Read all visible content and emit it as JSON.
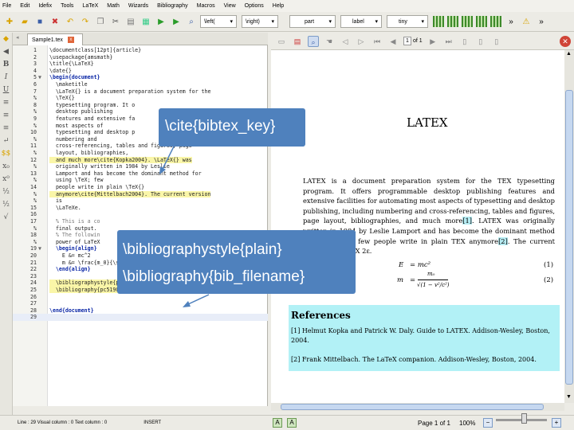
{
  "menu": [
    "File",
    "Edit",
    "Idefix",
    "Tools",
    "LaTeX",
    "Math",
    "Wizards",
    "Bibliography",
    "Macros",
    "View",
    "Options",
    "Help"
  ],
  "toolbar": {
    "left_dropdown": "\\left(",
    "right_dropdown": "\\right)",
    "part": "part",
    "label": "label",
    "size": "tiny"
  },
  "tab": {
    "name": "Sample1.tex"
  },
  "editor": {
    "lines": [
      {
        "n": "1",
        "m": "",
        "t": "\\documentclass[12pt]{article}"
      },
      {
        "n": "2",
        "m": "",
        "t": "\\usepackage{amsmath}"
      },
      {
        "n": "3",
        "m": "",
        "t": "\\title{\\LaTeX}"
      },
      {
        "n": "4",
        "m": "",
        "t": "\\date{}"
      },
      {
        "n": "5",
        "m": "▼",
        "t": "\\begin{document}"
      },
      {
        "n": "6",
        "m": "",
        "t": "  \\maketitle"
      },
      {
        "n": "7",
        "m": "",
        "t": "  \\LaTeX{} is a document preparation system for the"
      },
      {
        "n": "%",
        "m": "",
        "t": "  \\TeX{}"
      },
      {
        "n": "8",
        "m": "",
        "t": "  typesetting program. It o"
      },
      {
        "n": "%",
        "m": "",
        "t": "  desktop publishing"
      },
      {
        "n": "9",
        "m": "",
        "t": "  features and extensive fa"
      },
      {
        "n": "%",
        "m": "",
        "t": "  most aspects of"
      },
      {
        "n": "10",
        "m": "",
        "t": "  typesetting and desktop p"
      },
      {
        "n": "%",
        "m": "",
        "t": "  numbering and"
      },
      {
        "n": "11",
        "m": "",
        "t": "  cross-referencing, tables and figures, page"
      },
      {
        "n": "%",
        "m": "",
        "t": "  layout, bibliographies,"
      },
      {
        "n": "12",
        "m": "",
        "t": "  and much more\\cite{Kopka2004}. \\LaTeX{} was"
      },
      {
        "n": "%",
        "m": "",
        "t": "  originally written in 1984 by Leslie"
      },
      {
        "n": "13",
        "m": "",
        "t": "  Lamport and has become the dominant method for"
      },
      {
        "n": "%",
        "m": "",
        "t": "  using \\TeX; few"
      },
      {
        "n": "14",
        "m": "",
        "t": "  people write in plain \\TeX{}"
      },
      {
        "n": "%",
        "m": "",
        "t": "  anymore\\cite{Mittelbach2004}. The current version"
      },
      {
        "n": "%",
        "m": "",
        "t": "  is"
      },
      {
        "n": "15",
        "m": "",
        "t": "  \\LaTeXe."
      },
      {
        "n": "16",
        "m": "",
        "t": ""
      },
      {
        "n": "17",
        "m": "",
        "t": "  % This is a co"
      },
      {
        "n": "%",
        "m": "",
        "t": "  final output."
      },
      {
        "n": "18",
        "m": "",
        "t": "  % The followin"
      },
      {
        "n": "%",
        "m": "",
        "t": "  power of LaTeX"
      },
      {
        "n": "19",
        "m": "▼",
        "t": "  \\begin{align}"
      },
      {
        "n": "20",
        "m": "",
        "t": "    E &= mc^2"
      },
      {
        "n": "21",
        "m": "",
        "t": "    m &= \\frac{m_0}{\\sqrt{1-\\frac{v^2}{c^2}}}"
      },
      {
        "n": "22",
        "m": "",
        "t": "  \\end{align}"
      },
      {
        "n": "23",
        "m": "",
        "t": ""
      },
      {
        "n": "24",
        "m": "",
        "t": "  \\bibliographystyle{plain}"
      },
      {
        "n": "25",
        "m": "",
        "t": "  \\bibliography{pc5190}"
      },
      {
        "n": "26",
        "m": "",
        "t": ""
      },
      {
        "n": "27",
        "m": "",
        "t": ""
      },
      {
        "n": "28",
        "m": "",
        "t": "\\end{document}"
      },
      {
        "n": "29",
        "m": "",
        "t": ""
      }
    ]
  },
  "status": {
    "text": "Line : 29 Visual column : 0 Text column : 0",
    "mode": "INSERT"
  },
  "pdf": {
    "page": "1",
    "of": "of 1",
    "page_status": "Page 1 of 1",
    "zoom": "100%",
    "title": "LATEX",
    "para1": "LATEX is a document preparation system for the TEX typesetting program. It offers programmable desktop publishing features and extensive facilities for automating most aspects of typesetting and desktop publishing, including numbering and cross-referencing, tables and figures, page layout, bibliographies, and much more",
    "cite1": "[1]",
    "para2": ". LATEX was originally written in 1984 by Leslie Lamport and has become the dominant method for using TEX; few people write in plain TEX anymore",
    "cite2": "[2]",
    "para3": ". The current version is LATEX 2ε.",
    "eq1_lhs": "E",
    "eq1_rhs": "= mc²",
    "eq1_num": "(1)",
    "eq2_lhs": "m",
    "eq2_num_top": "m₀",
    "eq2_num": "(2)",
    "eq2_den": "√(1 − v²/c²)",
    "refs_heading": "References",
    "ref1": "[1]  Helmut Kopka and Patrick W. Daly. Guide to LATEX. Addison-Wesley, Boston, 2004.",
    "ref2": "[2]  Frank Mittelbach. The LaTeX companion. Addison-Wesley, Boston, 2004."
  },
  "callouts": {
    "cite": "\\cite{bibtex_key}",
    "bibstyle": "\\bibliographystyle{plain}",
    "bibfile": "\\bibliography{bib_filename}"
  }
}
